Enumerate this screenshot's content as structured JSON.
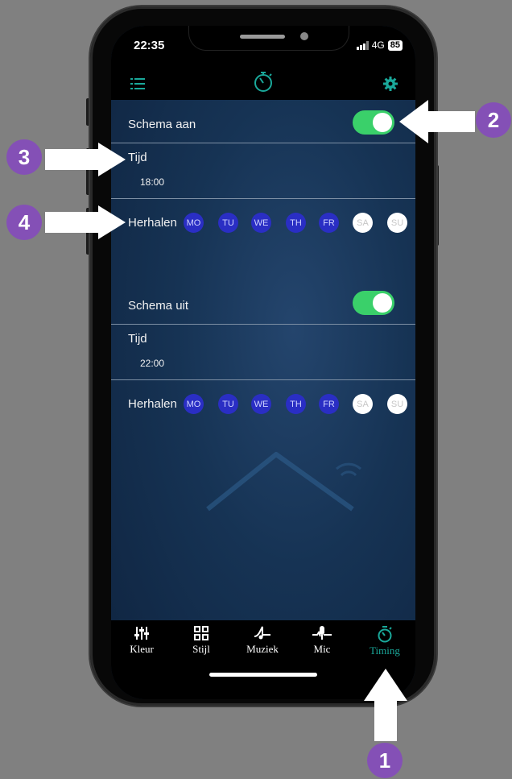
{
  "status": {
    "time": "22:35",
    "network": "4G",
    "battery": "85"
  },
  "schedule_on": {
    "title": "Schema aan",
    "time_label": "Tijd",
    "time_value": "18:00",
    "repeat_label": "Herhalen",
    "enabled": true,
    "days": [
      {
        "label": "MO",
        "selected": true
      },
      {
        "label": "TU",
        "selected": true
      },
      {
        "label": "WE",
        "selected": true
      },
      {
        "label": "TH",
        "selected": true
      },
      {
        "label": "FR",
        "selected": true
      },
      {
        "label": "SA",
        "selected": false
      },
      {
        "label": "SU",
        "selected": false
      }
    ]
  },
  "schedule_off": {
    "title": "Schema uit",
    "time_label": "Tijd",
    "time_value": "22:00",
    "repeat_label": "Herhalen",
    "enabled": true,
    "days": [
      {
        "label": "MO",
        "selected": true
      },
      {
        "label": "TU",
        "selected": true
      },
      {
        "label": "WE",
        "selected": true
      },
      {
        "label": "TH",
        "selected": true
      },
      {
        "label": "FR",
        "selected": true
      },
      {
        "label": "SA",
        "selected": false
      },
      {
        "label": "SU",
        "selected": false
      }
    ]
  },
  "tabs": [
    {
      "label": "Kleur",
      "icon": "sliders-icon"
    },
    {
      "label": "Stijl",
      "icon": "grid-icon"
    },
    {
      "label": "Muziek",
      "icon": "music-icon"
    },
    {
      "label": "Mic",
      "icon": "mic-icon"
    },
    {
      "label": "Timing",
      "icon": "timer-icon",
      "active": true
    }
  ],
  "annotations": [
    "1",
    "2",
    "3",
    "4"
  ],
  "colors": {
    "accent": "#1aa89a",
    "toggle_on": "#3ad06a",
    "day_selected": "#2a2ec4",
    "badge": "#8450b6"
  }
}
